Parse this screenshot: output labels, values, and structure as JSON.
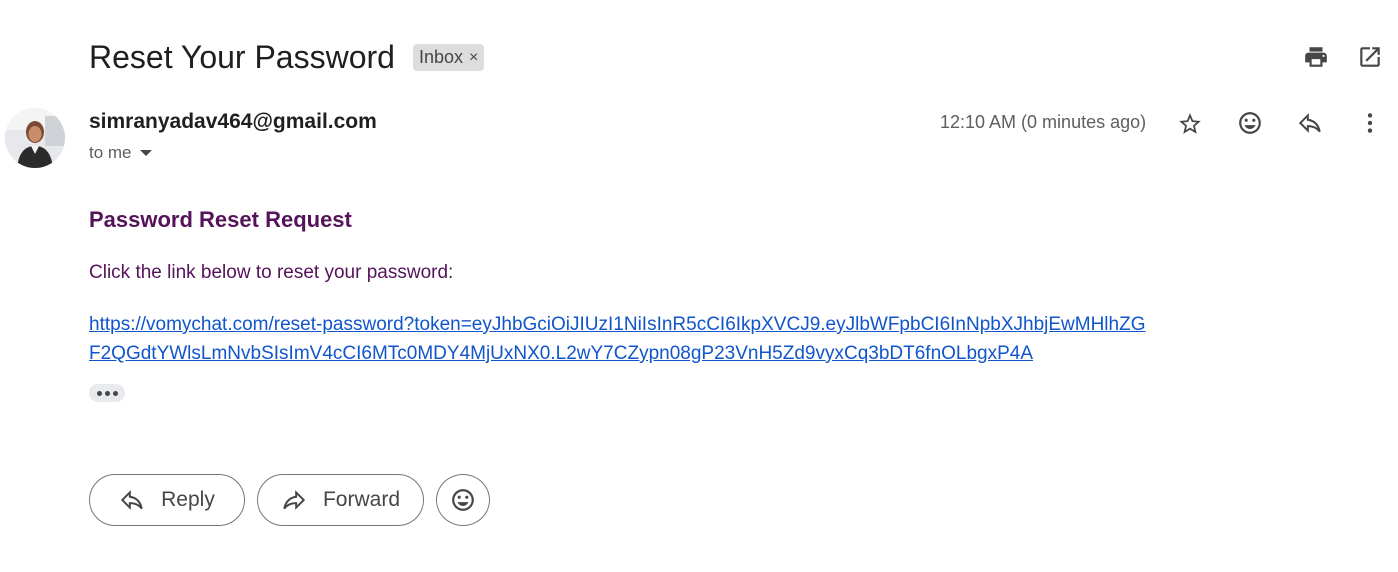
{
  "email": {
    "subject": "Reset Your Password",
    "label": "Inbox",
    "label_remove": "×",
    "sender": "simranyadav464@gmail.com",
    "recipient": "to me",
    "timestamp": "12:10 AM (0 minutes ago)"
  },
  "body": {
    "heading": "Password Reset Request",
    "text": "Click the link below to reset your password:",
    "link_line1": "https://vomychat.com/reset-password?token=eyJhbGciOiJIUzI1NiIsInR5cCI6IkpXVCJ9.eyJlbWFpbCI6InNpbXJhbjEwMHlhZG",
    "link_line2": "F2QGdtYWlsLmNvbSIsImV4cCI6MTc0MDY4MjUxNX0.L2wY7CZypn08gP23VnH5Zd9vyxCq3bDT6fnOLbgxP4A",
    "colors": {
      "heading": "#55135a",
      "link": "#1155cc"
    }
  },
  "actions": {
    "reply": "Reply",
    "forward": "Forward"
  },
  "icons": {
    "header": [
      "print-icon",
      "open-new-window-icon"
    ],
    "message": [
      "star-icon",
      "emoji-icon",
      "reply-icon",
      "more-vert-icon"
    ]
  }
}
